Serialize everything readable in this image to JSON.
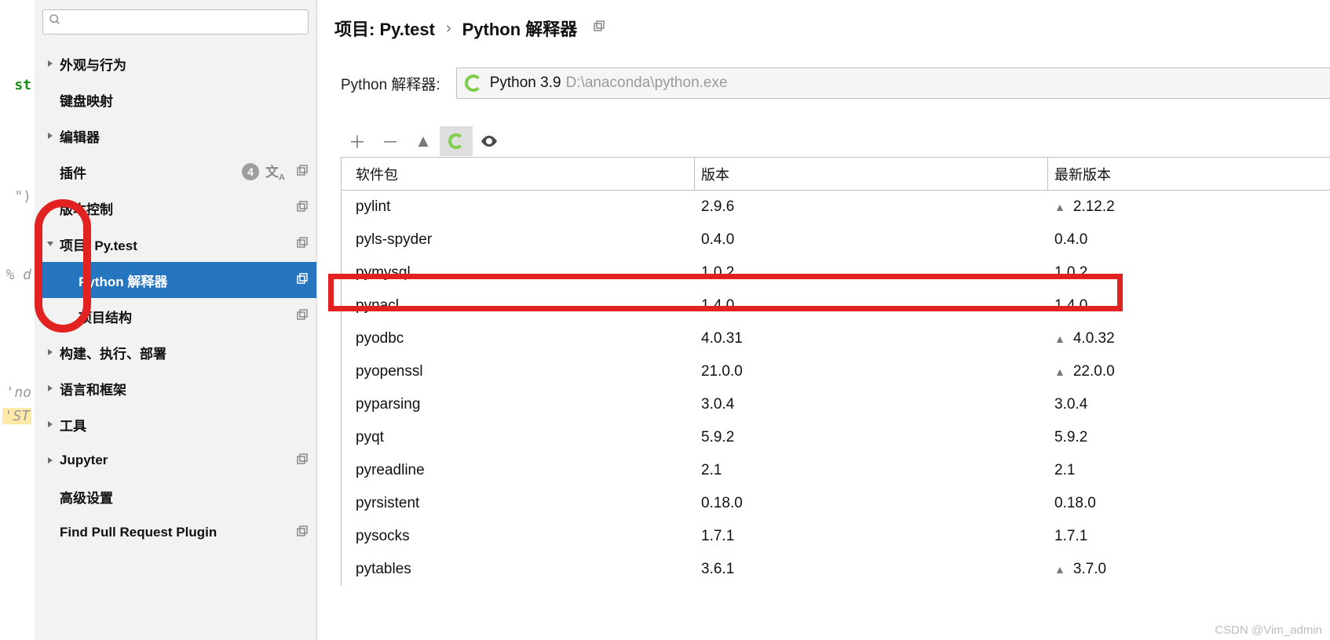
{
  "leftFragments": [
    "st",
    "\")",
    "% d",
    "'no",
    "'ST"
  ],
  "search": {
    "placeholder": ""
  },
  "sidebar": {
    "items": [
      {
        "label": "外观与行为",
        "arrow": ">"
      },
      {
        "label": "键盘映射",
        "arrow": ""
      },
      {
        "label": "编辑器",
        "arrow": ">"
      },
      {
        "label": "插件",
        "arrow": "",
        "badge": "4",
        "lang": true,
        "overlay": true
      },
      {
        "label": "版本控制",
        "arrow": ">",
        "overlay": true
      },
      {
        "label": "项目: Py.test",
        "arrow": "v",
        "overlay": true
      },
      {
        "label": "Python 解释器",
        "arrow": "",
        "overlay": true,
        "child": true,
        "selected": true
      },
      {
        "label": "项目结构",
        "arrow": "",
        "overlay": true,
        "child": true
      },
      {
        "label": "构建、执行、部署",
        "arrow": ">"
      },
      {
        "label": "语言和框架",
        "arrow": ">"
      },
      {
        "label": "工具",
        "arrow": ">"
      },
      {
        "label": "Jupyter",
        "arrow": ">",
        "overlay": true
      },
      {
        "label": "高级设置",
        "arrow": ""
      },
      {
        "label": "Find Pull Request Plugin",
        "arrow": "",
        "overlay": true
      }
    ]
  },
  "breadcrumb": {
    "crumb1": "项目: Py.test",
    "crumb2": "Python 解释器"
  },
  "interpreter": {
    "label": "Python 解释器:",
    "name": "Python 3.9",
    "path": "D:\\anaconda\\python.exe"
  },
  "table": {
    "headers": {
      "c1": "软件包",
      "c2": "版本",
      "c3": "最新版本"
    },
    "rows": [
      {
        "name": "pylint",
        "ver": "2.9.6",
        "latest": "2.12.2",
        "up": true
      },
      {
        "name": "pyls-spyder",
        "ver": "0.4.0",
        "latest": "0.4.0",
        "up": false
      },
      {
        "name": "pymysql",
        "ver": "1.0.2",
        "latest": "1.0.2",
        "up": false
      },
      {
        "name": "pynacl",
        "ver": "1.4.0",
        "latest": "1.4.0",
        "up": false
      },
      {
        "name": "pyodbc",
        "ver": "4.0.31",
        "latest": "4.0.32",
        "up": true
      },
      {
        "name": "pyopenssl",
        "ver": "21.0.0",
        "latest": "22.0.0",
        "up": true
      },
      {
        "name": "pyparsing",
        "ver": "3.0.4",
        "latest": "3.0.4",
        "up": false
      },
      {
        "name": "pyqt",
        "ver": "5.9.2",
        "latest": "5.9.2",
        "up": false
      },
      {
        "name": "pyreadline",
        "ver": "2.1",
        "latest": "2.1",
        "up": false
      },
      {
        "name": "pyrsistent",
        "ver": "0.18.0",
        "latest": "0.18.0",
        "up": false
      },
      {
        "name": "pysocks",
        "ver": "1.7.1",
        "latest": "1.7.1",
        "up": false
      },
      {
        "name": "pytables",
        "ver": "3.6.1",
        "latest": "3.7.0",
        "up": true
      }
    ]
  },
  "watermark": "CSDN @Vim_admin"
}
